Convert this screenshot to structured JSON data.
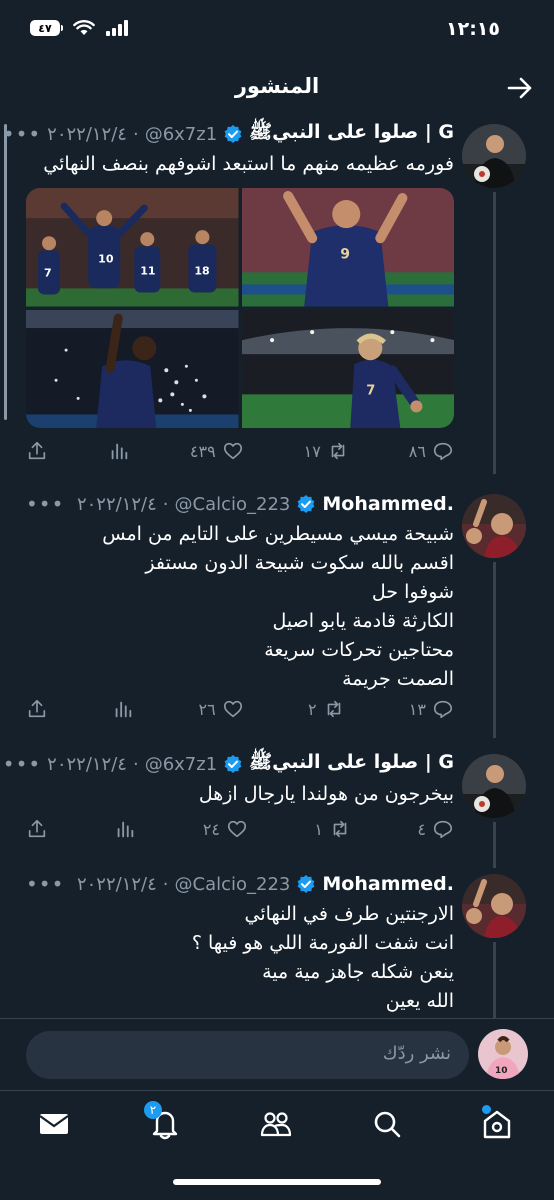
{
  "status_bar": {
    "time": "١٢:١٥",
    "battery": "٤٧"
  },
  "header": {
    "title": "المنشور"
  },
  "tweets": [
    {
      "name": "صلوا على النبيﷺ | G",
      "handle": "@6x7z1",
      "date": "٢٠٢٢/١٢/٤",
      "lines": [
        "فورمه عظيمه منهم ما استبعد اشوفهم بنصف النهائي"
      ],
      "stats": {
        "replies": "٨٦",
        "retweets": "١٧",
        "likes": "٤٣٩"
      }
    },
    {
      "name": "Mohammed.",
      "handle": "@Calcio_223",
      "date": "٢٠٢٢/١٢/٤",
      "lines": [
        "شبيحة ميسي مسيطرين على التايم من امس",
        "اقسم بالله سكوت شبيحة الدون مستفز",
        "شوفوا حل",
        "الكارثة قادمة يابو اصيل",
        "محتاجين تحركات سريعة",
        "الصمت جريمة"
      ],
      "stats": {
        "replies": "١٣",
        "retweets": "٢",
        "likes": "٢٦"
      }
    },
    {
      "name": "صلوا على النبيﷺ | G",
      "handle": "@6x7z1",
      "date": "٢٠٢٢/١٢/٤",
      "lines": [
        "بيخرجون من هولندا يارجال ازهل"
      ],
      "stats": {
        "replies": "٤",
        "retweets": "١",
        "likes": "٢٤"
      }
    },
    {
      "name": "Mohammed.",
      "handle": "@Calcio_223",
      "date": "٢٠٢٢/١٢/٤",
      "lines": [
        "الارجنتين طرف في النهائي",
        "انت شفت الفورمة اللي هو فيها ؟",
        "ينعن شكله جاهز مية مية",
        "الله يعين"
      ]
    }
  ],
  "composer": {
    "placeholder": "نشر ردّك"
  },
  "nav": {
    "notifications_badge": "٢"
  },
  "colors": {
    "background": "#15202b",
    "accent": "#1d9bf0",
    "secondary_text": "#8b98a5",
    "divider": "#38444d"
  },
  "icons": [
    "back-arrow-icon",
    "verified-icon",
    "more-icon",
    "reply-icon",
    "retweet-icon",
    "like-icon",
    "views-icon",
    "share-icon",
    "home-icon",
    "search-icon",
    "communities-icon",
    "notifications-icon",
    "messages-icon"
  ]
}
